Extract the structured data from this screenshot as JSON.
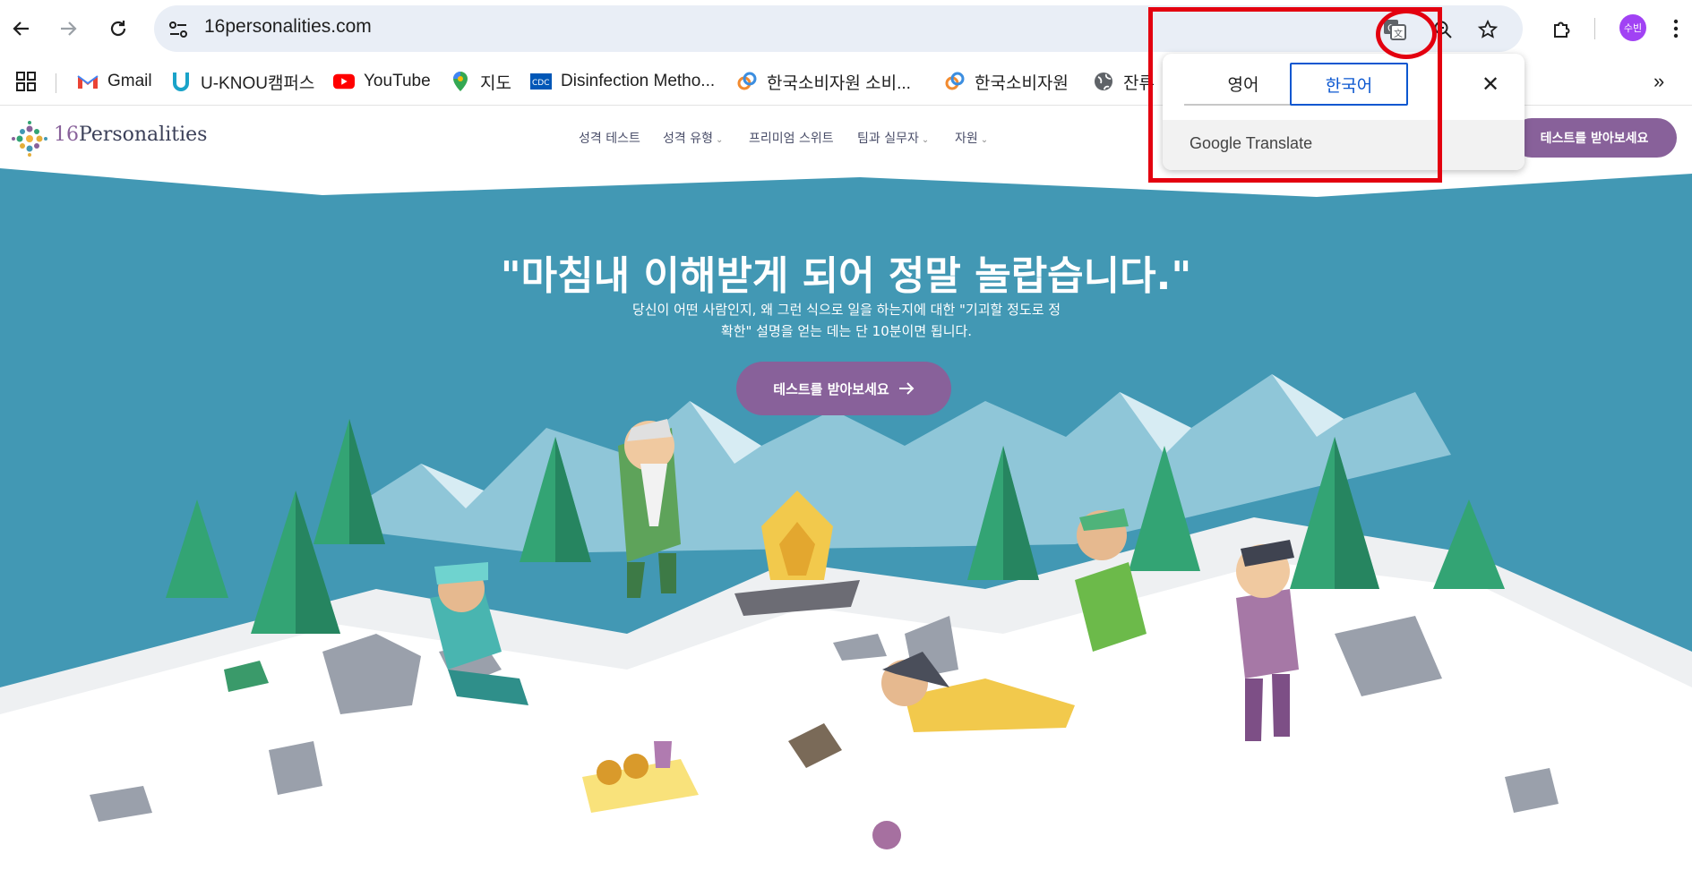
{
  "browser": {
    "url": "16personalities.com",
    "bookmarks": [
      {
        "label": "Gmail",
        "icon": "gmail-icon"
      },
      {
        "label": "U-KNOU캠퍼스",
        "icon": "uknou-icon"
      },
      {
        "label": "YouTube",
        "icon": "youtube-icon"
      },
      {
        "label": "지도",
        "icon": "maps-icon"
      },
      {
        "label": "Disinfection Metho...",
        "icon": "cdc-icon"
      },
      {
        "label": "한국소비자원 소비...",
        "icon": "kca-icon"
      },
      {
        "label": "한국소비자원",
        "icon": "kca-icon"
      },
      {
        "label": "잔류",
        "icon": "globe-icon"
      }
    ],
    "profile_initials": "수빈"
  },
  "translate_popup": {
    "source_lang": "영어",
    "target_lang": "한국어",
    "footer": "Google Translate"
  },
  "site": {
    "logo_num": "16",
    "logo_word": "Personalities",
    "nav": [
      "성격 테스트",
      "성격 유형",
      "프리미엄 스위트",
      "팀과 실무자",
      "자원"
    ],
    "header_cta": "테스트를 받아보세요"
  },
  "hero": {
    "title": "\"마침내 이해받게 되어 정말 놀랍습니다.\"",
    "subtitle": "당신이 어떤 사람인지, 왜 그런 식으로 일을 하는지에 대한 \"기괴할 정도로 정확한\" 설명을 얻는 데는 단 10분이면 됩니다.",
    "cta": "테스트를 받아보세요"
  },
  "colors": {
    "brand_purple": "#88619a",
    "hero_teal": "#4298b4",
    "highlight_red": "#e3000f",
    "omnibox_bg": "#e9eef6"
  }
}
